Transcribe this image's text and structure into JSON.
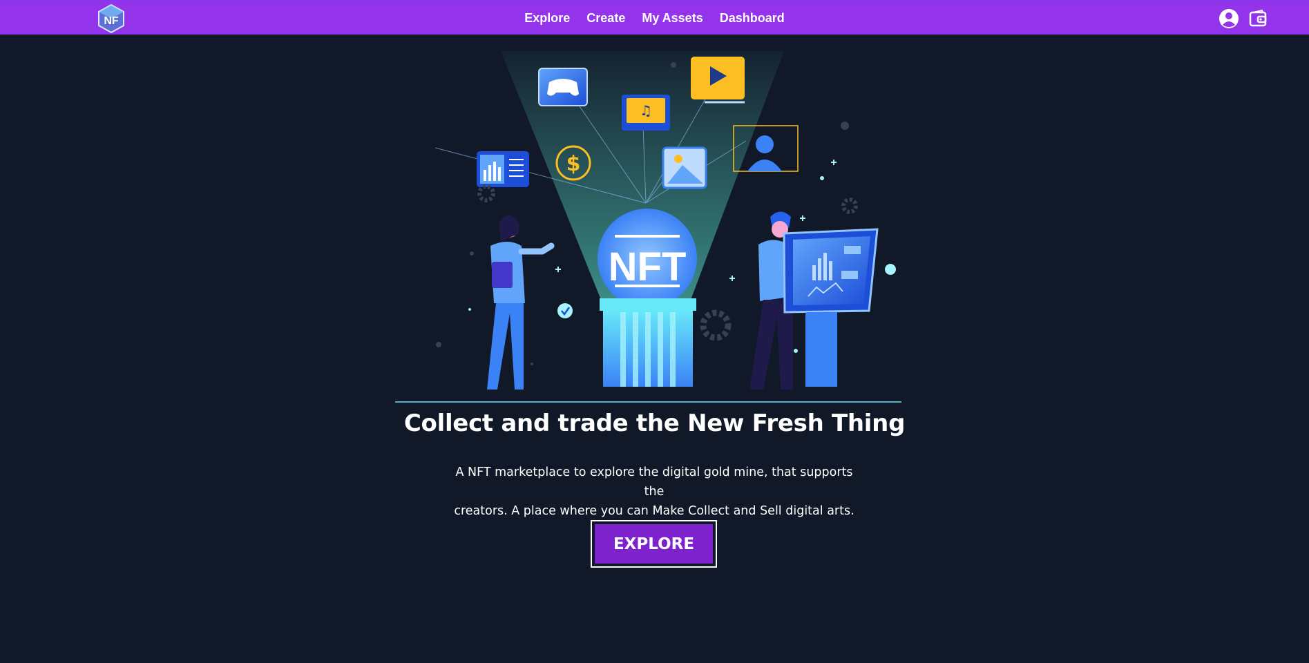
{
  "nav": {
    "links": [
      "Explore",
      "Create",
      "My Assets",
      "Dashboard"
    ],
    "icons": [
      "user-icon",
      "wallet-icon"
    ],
    "logo_icon": "nft-cube-logo-icon"
  },
  "hero": {
    "art_label": "NFT",
    "title": "Collect and trade the New Fresh Thing",
    "subtitle_line1": "A NFT marketplace to explore the digital gold mine, that supports the",
    "subtitle_line2": "creators. A place where you can Make Collect and Sell digital arts.",
    "cta_label": "EXPLORE"
  },
  "colors": {
    "navbar": "#9333ea",
    "background": "#111827",
    "cta": "#7e22ce"
  }
}
